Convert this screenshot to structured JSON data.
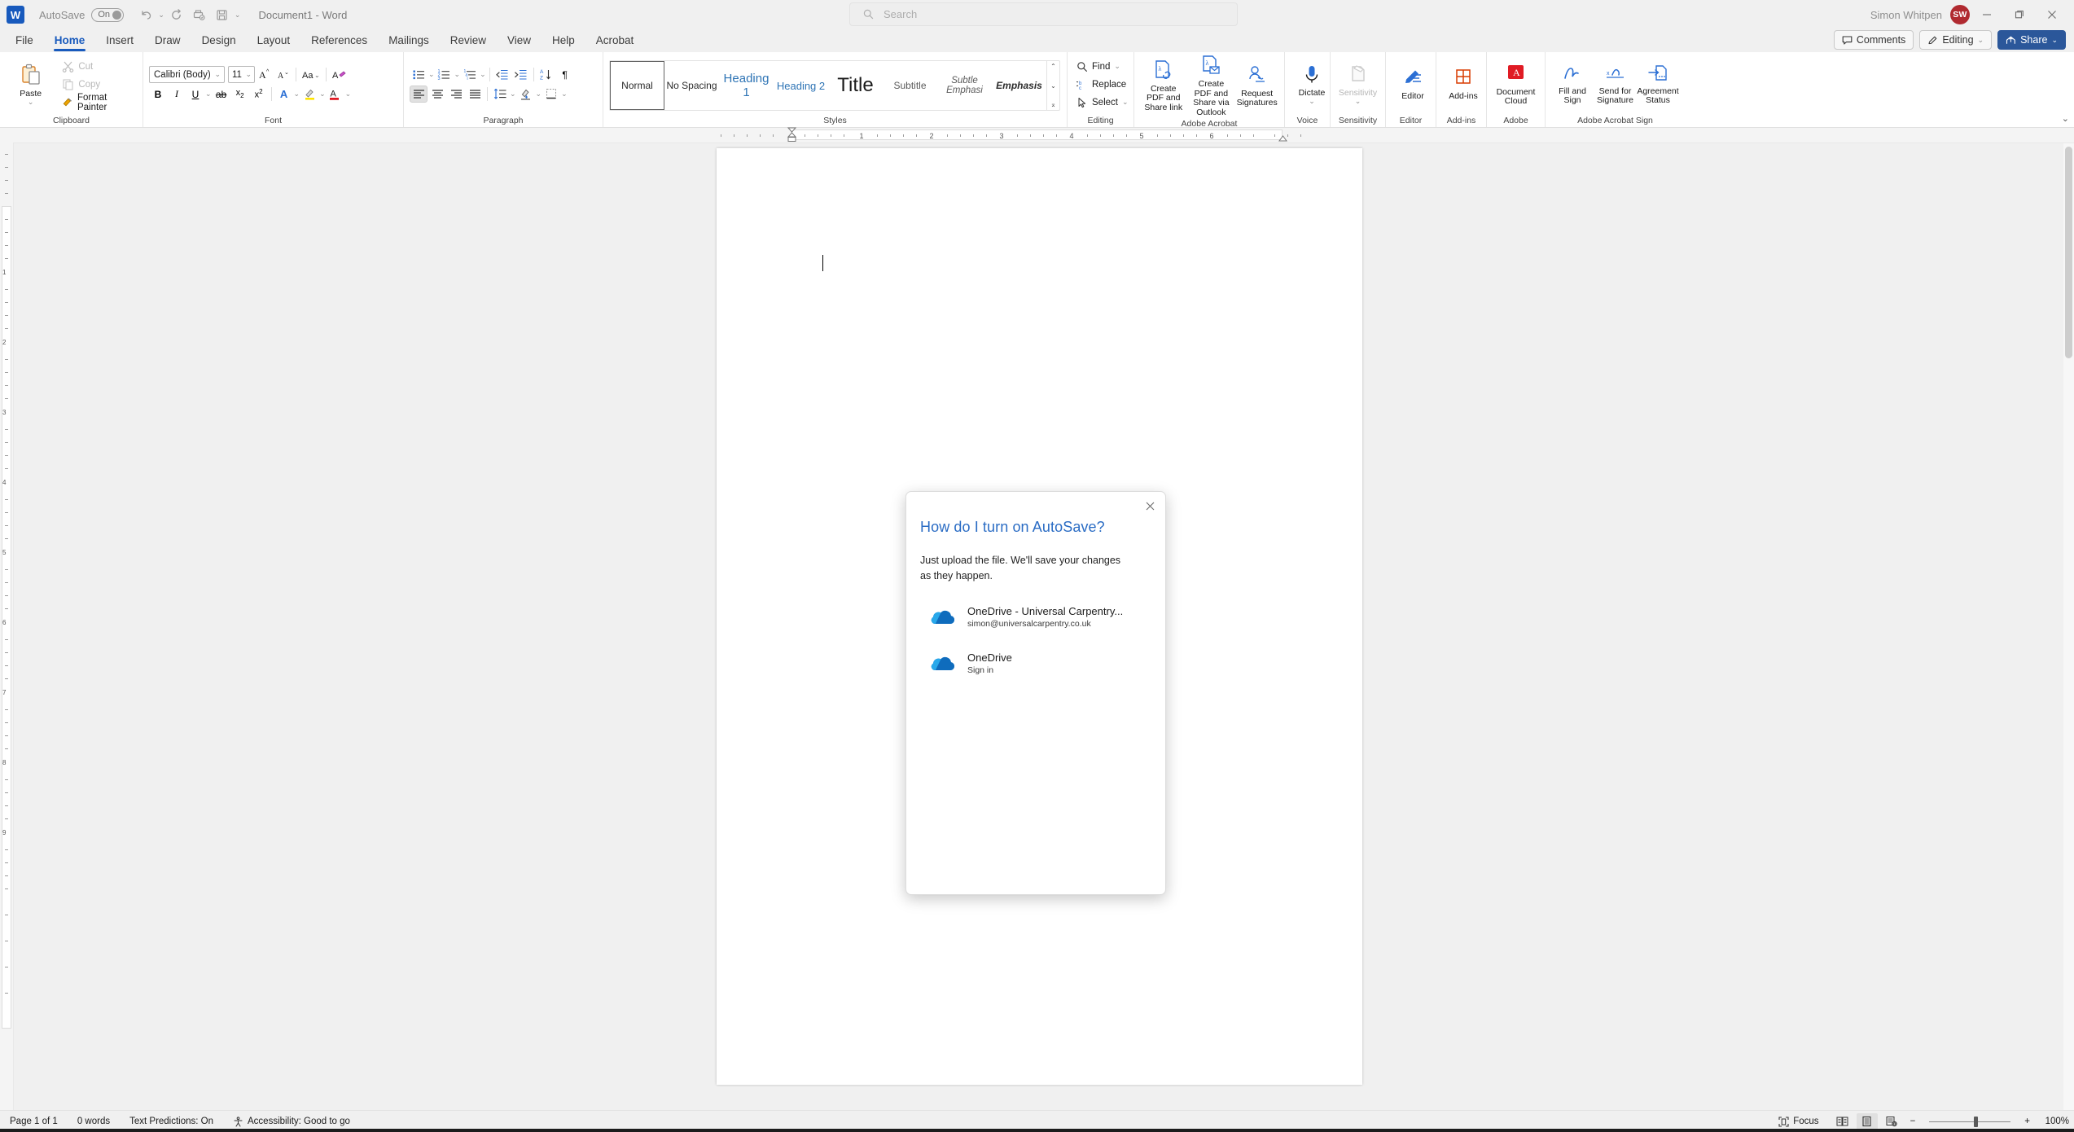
{
  "titlebar": {
    "autosave_label": "AutoSave",
    "autosave_state": "On",
    "document_title": "Document1  -  Word",
    "user_name": "Simon Whitpen",
    "avatar_initials": "SW",
    "qat": [
      {
        "name": "undo",
        "label": "Undo"
      },
      {
        "name": "redo",
        "label": "Redo"
      },
      {
        "name": "print-preview",
        "label": "Print Preview and Print"
      },
      {
        "name": "save",
        "label": "Save"
      },
      {
        "name": "customize-qat",
        "label": "Customize Quick Access Toolbar"
      }
    ],
    "window_buttons": [
      "minimize",
      "restore",
      "close"
    ]
  },
  "search": {
    "placeholder": "Search",
    "icon": "search-icon"
  },
  "tabs": [
    {
      "label": "File",
      "active": false
    },
    {
      "label": "Home",
      "active": true
    },
    {
      "label": "Insert",
      "active": false
    },
    {
      "label": "Draw",
      "active": false
    },
    {
      "label": "Design",
      "active": false
    },
    {
      "label": "Layout",
      "active": false
    },
    {
      "label": "References",
      "active": false
    },
    {
      "label": "Mailings",
      "active": false
    },
    {
      "label": "Review",
      "active": false
    },
    {
      "label": "View",
      "active": false
    },
    {
      "label": "Help",
      "active": false
    },
    {
      "label": "Acrobat",
      "active": false
    }
  ],
  "tab_actions": {
    "comments": "Comments",
    "editing": "Editing",
    "share": "Share"
  },
  "ribbon": {
    "clipboard": {
      "group_label": "Clipboard",
      "paste": "Paste",
      "cut": "Cut",
      "copy": "Copy",
      "format_painter": "Format Painter"
    },
    "font": {
      "group_label": "Font",
      "font_name": "Calibri (Body)",
      "font_size": "11",
      "buttons": [
        "grow-font",
        "shrink-font",
        "change-case",
        "clear-formatting",
        "bold",
        "italic",
        "underline",
        "strikethrough",
        "subscript",
        "superscript",
        "text-effects",
        "text-highlight",
        "font-color"
      ]
    },
    "paragraph": {
      "group_label": "Paragraph",
      "buttons": [
        "bullets",
        "numbering",
        "multilevel-list",
        "decrease-indent",
        "increase-indent",
        "sort",
        "show-formatting-marks",
        "align-left",
        "align-center",
        "align-right",
        "justify",
        "line-spacing",
        "shading",
        "borders"
      ]
    },
    "styles": {
      "group_label": "Styles",
      "items": [
        {
          "label": "Normal",
          "selected": true
        },
        {
          "label": "No Spacing",
          "selected": false
        },
        {
          "label": "Heading 1",
          "selected": false
        },
        {
          "label": "Heading 2",
          "selected": false
        },
        {
          "label": "Title",
          "selected": false
        },
        {
          "label": "Subtitle",
          "selected": false
        },
        {
          "label": "Subtle Emphasi",
          "selected": false
        },
        {
          "label": "Emphasis",
          "selected": false
        }
      ]
    },
    "editing": {
      "group_label": "Editing",
      "find": "Find",
      "replace": "Replace",
      "select": "Select"
    },
    "adobe_acrobat": {
      "group_label": "Adobe Acrobat",
      "items": [
        "Create PDF and Share link",
        "Create PDF and Share via Outlook",
        "Request Signatures"
      ]
    },
    "voice": {
      "group_label": "Voice",
      "dictate": "Dictate"
    },
    "sensitivity": {
      "group_label": "Sensitivity",
      "label": "Sensitivity"
    },
    "editor_group": {
      "group_label": "Editor",
      "label": "Editor"
    },
    "addins": {
      "group_label": "Add-ins",
      "label": "Add-ins"
    },
    "adobe": {
      "group_label": "Adobe",
      "label": "Document Cloud"
    },
    "acrobat_sign": {
      "group_label": "Adobe Acrobat Sign",
      "items": [
        "Fill and Sign",
        "Send for Signature",
        "Agreement Status"
      ]
    }
  },
  "ruler": {
    "h_numbers": [
      "1",
      "2",
      "3",
      "4",
      "5",
      "6"
    ],
    "v_numbers": [
      "1",
      "2",
      "3",
      "4",
      "5",
      "6",
      "7",
      "8",
      "9"
    ]
  },
  "dialog": {
    "title": "How do I turn on AutoSave?",
    "body": "Just upload the file. We'll save your changes as they happen.",
    "close_icon": "close-icon",
    "items": [
      {
        "icon": "onedrive-icon",
        "name": "OneDrive - Universal Carpentry...",
        "sub": "simon@universalcarpentry.co.uk"
      },
      {
        "icon": "onedrive-icon",
        "name": "OneDrive",
        "sub": "Sign in"
      }
    ]
  },
  "statusbar": {
    "page": "Page 1 of 1",
    "words": "0 words",
    "text_predictions": "Text Predictions: On",
    "accessibility": "Accessibility: Good to go",
    "focus": "Focus",
    "views": [
      {
        "name": "read-mode",
        "selected": false
      },
      {
        "name": "print-layout",
        "selected": true
      },
      {
        "name": "web-layout",
        "selected": false
      }
    ],
    "zoom_out": "−",
    "zoom_in": "+",
    "zoom_level": "100%"
  },
  "colors": {
    "accent": "#185abd",
    "share": "#2b579a",
    "dialog_title": "#2a6cc4",
    "avatar": "#b02a30",
    "onedrive": "#0f78d4"
  }
}
